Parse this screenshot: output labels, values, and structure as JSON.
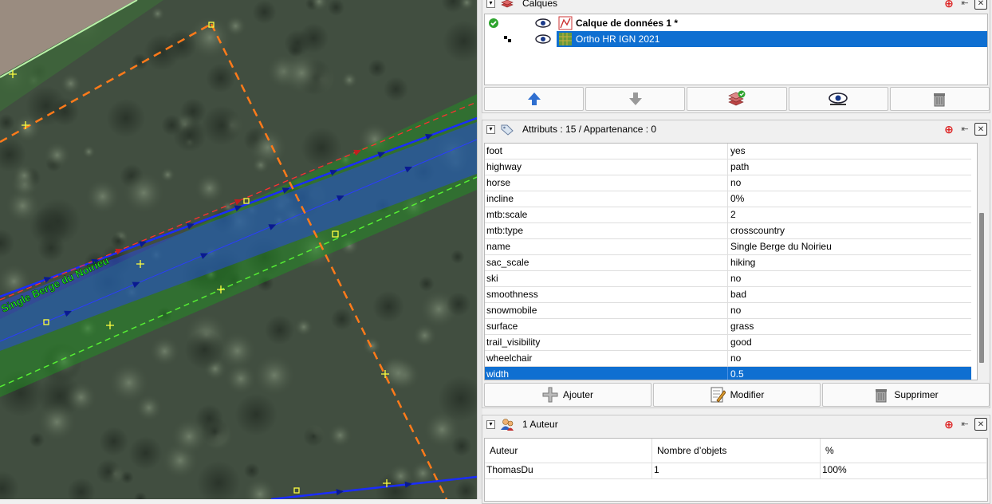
{
  "map": {
    "way_label": "Single Berge du Noirieu",
    "colors": {
      "selection": "#1030ff",
      "tag_green": "#19b01f",
      "boundary_orange": "#ff7a1a",
      "label_green": "#22ee22"
    }
  },
  "layers_panel": {
    "title": "Calques",
    "layers": [
      {
        "name": "Calque de données 1 *",
        "state": "active",
        "icon": "data-layer-icon",
        "selected": false
      },
      {
        "name": "Ortho HR IGN 2021",
        "state": "background",
        "icon": "imagery-layer-icon",
        "selected": true
      }
    ],
    "buttons": [
      {
        "name": "move-up-button",
        "icon": "arrow-up-icon"
      },
      {
        "name": "move-down-button",
        "icon": "arrow-down-icon"
      },
      {
        "name": "activate-layer-button",
        "icon": "activate-layer-icon"
      },
      {
        "name": "toggle-visibility-button",
        "icon": "eye-icon"
      },
      {
        "name": "delete-layer-button",
        "icon": "trash-icon"
      }
    ]
  },
  "attributes_panel": {
    "title": "Attributs : 15 / Appartenance : 0",
    "rows": [
      {
        "key": "foot",
        "value": "yes"
      },
      {
        "key": "highway",
        "value": "path"
      },
      {
        "key": "horse",
        "value": "no"
      },
      {
        "key": "incline",
        "value": "0%"
      },
      {
        "key": "mtb:scale",
        "value": "2"
      },
      {
        "key": "mtb:type",
        "value": "crosscountry"
      },
      {
        "key": "name",
        "value": "Single Berge du Noirieu"
      },
      {
        "key": "sac_scale",
        "value": "hiking"
      },
      {
        "key": "ski",
        "value": "no"
      },
      {
        "key": "smoothness",
        "value": "bad"
      },
      {
        "key": "snowmobile",
        "value": "no"
      },
      {
        "key": "surface",
        "value": "grass"
      },
      {
        "key": "trail_visibility",
        "value": "good"
      },
      {
        "key": "wheelchair",
        "value": "no"
      },
      {
        "key": "width",
        "value": "0.5"
      }
    ],
    "selected_row": 14,
    "buttons": {
      "add": "Ajouter",
      "edit": "Modifier",
      "delete": "Supprimer"
    }
  },
  "authors_panel": {
    "title": "1 Auteur",
    "columns": [
      "Auteur",
      "Nombre d’objets",
      "%"
    ],
    "rows": [
      [
        "ThomasDu",
        "1",
        "100%"
      ]
    ]
  }
}
